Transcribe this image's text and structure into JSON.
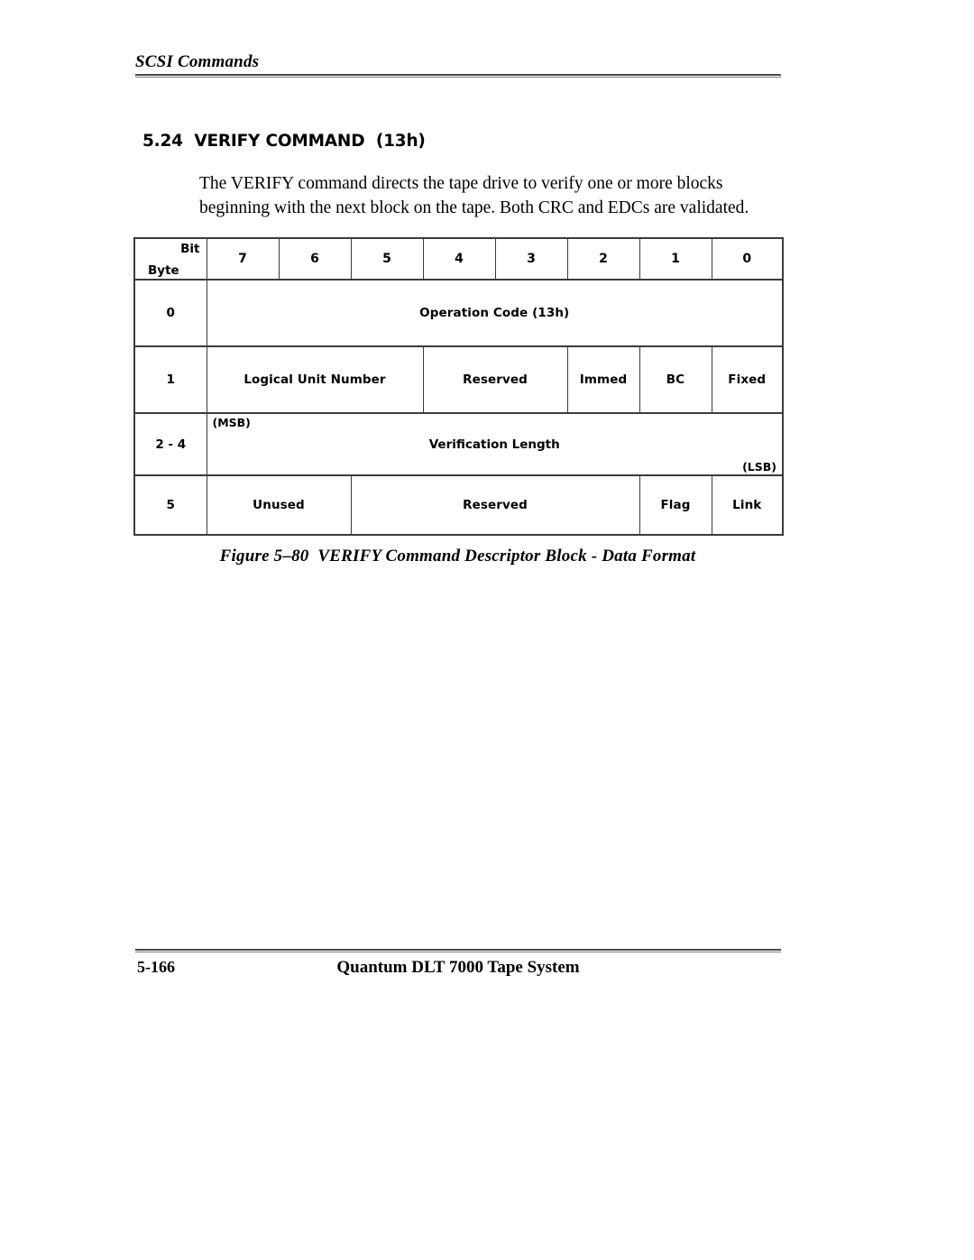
{
  "header": {
    "running_title": "SCSI Commands"
  },
  "section": {
    "number": "5.24",
    "title": "VERIFY COMMAND  (13h)",
    "heading_full": "5.24  VERIFY COMMAND  (13h)"
  },
  "intro": {
    "paragraph": "The VERIFY command directs the tape drive to verify one or more blocks beginning with the next block on the tape. Both CRC and EDCs are validated."
  },
  "table": {
    "corner": {
      "bit_label": "Bit",
      "byte_label": "Byte"
    },
    "bit_headers": [
      "7",
      "6",
      "5",
      "4",
      "3",
      "2",
      "1",
      "0"
    ],
    "rows": [
      {
        "byte": "0",
        "cells": [
          {
            "label": "Operation Code (13h)",
            "bits": 8
          }
        ]
      },
      {
        "byte": "1",
        "cells": [
          {
            "label": "Logical Unit Number",
            "bits": 3
          },
          {
            "label": "Reserved",
            "bits": 2
          },
          {
            "label": "Immed",
            "bits": 1
          },
          {
            "label": "BC",
            "bits": 1
          },
          {
            "label": "Fixed",
            "bits": 1
          }
        ]
      },
      {
        "byte": "2 - 4",
        "cells": [
          {
            "label": "Verification Length",
            "bits": 8,
            "msb": "(MSB)",
            "lsb": "(LSB)"
          }
        ]
      },
      {
        "byte": "5",
        "cells": [
          {
            "label": "Unused",
            "bits": 2
          },
          {
            "label": "Reserved",
            "bits": 4
          },
          {
            "label": "Flag",
            "bits": 1
          },
          {
            "label": "Link",
            "bits": 1
          }
        ]
      }
    ]
  },
  "figure": {
    "caption": "Figure 5–80  VERIFY Command Descriptor Block - Data Format"
  },
  "footer": {
    "page_number": "5-166",
    "product_title": "Quantum DLT 7000 Tape System"
  },
  "colors": {
    "text": "#000000",
    "rule": "#4a4a4a",
    "table_border": "#3b3b3b",
    "background": "#ffffff"
  }
}
